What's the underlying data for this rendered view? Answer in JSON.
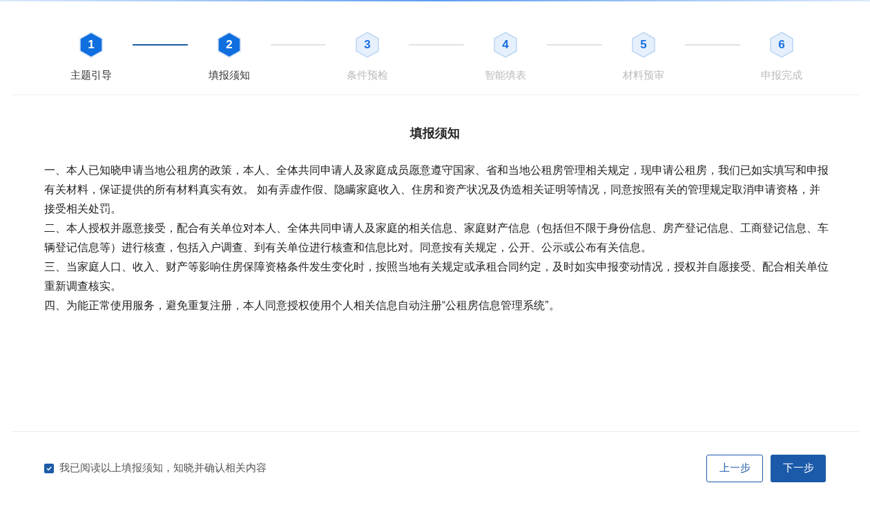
{
  "steps": [
    {
      "number": "1",
      "label": "主题引导",
      "reached": true
    },
    {
      "number": "2",
      "label": "填报须知",
      "reached": true
    },
    {
      "number": "3",
      "label": "条件预检",
      "reached": false
    },
    {
      "number": "4",
      "label": "智能填表",
      "reached": false
    },
    {
      "number": "5",
      "label": "材料预审",
      "reached": false
    },
    {
      "number": "6",
      "label": "申报完成",
      "reached": false
    }
  ],
  "notice": {
    "title": "填报须知",
    "paragraphs": [
      "一、本人已知晓申请当地公租房的政策，本人、全体共同申请人及家庭成员愿意遵守国家、省和当地公租房管理相关规定，现申请公租房，我们已如实填写和申报有关材料，保证提供的所有材料真实有效。 如有弄虚作假、隐瞒家庭收入、住房和资产状况及伪造相关证明等情况，同意按照有关的管理规定取消申请资格，并接受相关处罚。",
      "二、本人授权并愿意接受，配合有关单位对本人、全体共同申请人及家庭的相关信息、家庭财产信息（包括但不限于身份信息、房产登记信息、工商登记信息、车辆登记信息等）进行核查，包括入户调查、到有关单位进行核查和信息比对。同意按有关规定，公开、公示或公布有关信息。",
      "三、当家庭人口、收入、财产等影响住房保障资格条件发生变化时，按照当地有关规定或承租合同约定，及时如实申报变动情况，授权并自愿接受、配合相关单位重新调查核实。",
      "四、为能正常使用服务，避免重复注册，本人同意授权使用个人相关信息自动注册“公租房信息管理系统”。"
    ]
  },
  "agreement": {
    "label": "我已阅读以上填报须知，知晓并确认相关内容",
    "checked": true
  },
  "buttons": {
    "previous": "上一步",
    "next": "下一步"
  }
}
